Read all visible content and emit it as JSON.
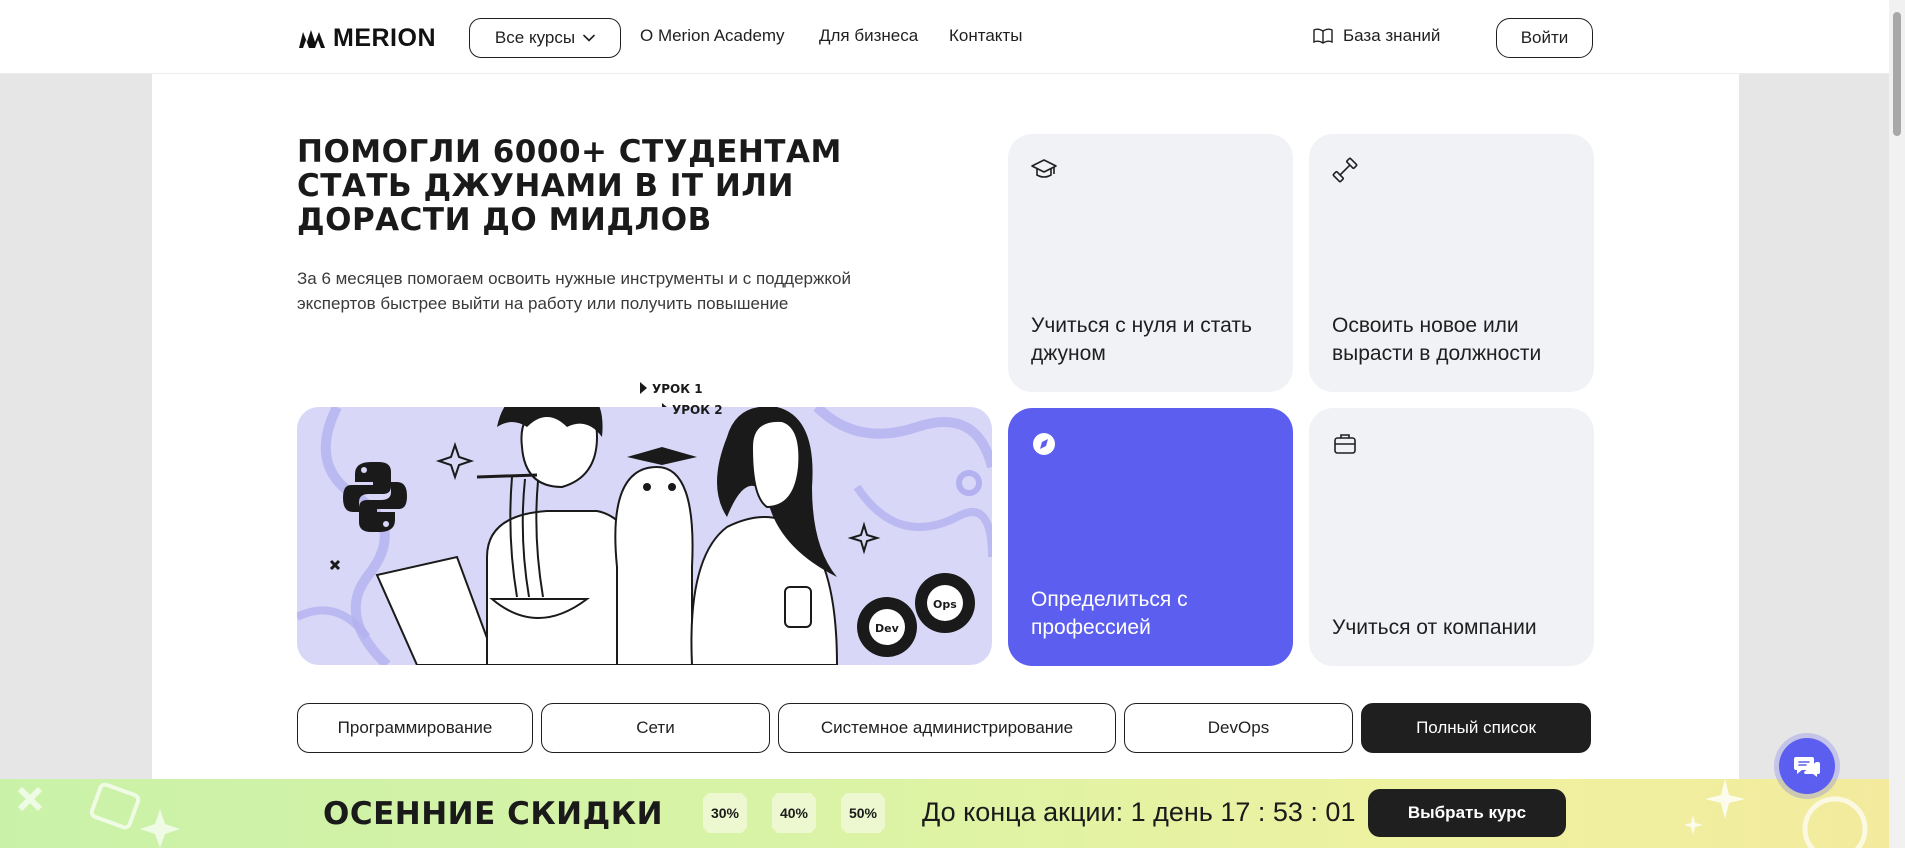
{
  "header": {
    "logo_text": "MERION",
    "courses_button": "Все курсы",
    "nav": [
      "О Merion Academy",
      "Для бизнеса",
      "Контакты"
    ],
    "knowledge_base": "База знаний",
    "login": "Войти"
  },
  "hero": {
    "title": "Помогли 6000+ студентам стать джунами в IT или дорасти до мидлов",
    "subtitle": "За 6 месяцев помогаем освоить нужные инструменты и с поддержкой экспертов быстрее выйти на работу или получить повышение",
    "illustration": {
      "lesson_1": "УРОК 1",
      "lesson_2": "УРОК 2",
      "devops_dev": "Dev",
      "devops_ops": "Ops"
    }
  },
  "cards": [
    {
      "label": "Учиться с нуля и стать джуном",
      "icon": "graduation-cap-icon"
    },
    {
      "label": "Освоить новое или вырасти в должности",
      "icon": "dumbbell-icon"
    },
    {
      "label": "Определиться с профессией",
      "icon": "compass-icon",
      "active": true
    },
    {
      "label": "Учиться от компании",
      "icon": "briefcase-icon"
    }
  ],
  "categories": [
    "Программирование",
    "Сети",
    "Системное администрирование",
    "DevOps",
    "Полный список"
  ],
  "promo": {
    "title": "ОСЕННИЕ СКИДКИ",
    "badges": [
      "30%",
      "40%",
      "50%"
    ],
    "countdown": "До конца акции: 1 день 17 : 53 : 01",
    "button": "Выбрать курс"
  },
  "colors": {
    "accent": "#5c5ef0",
    "card_bg": "#f1f2f6",
    "illustration_bg": "#d8d7f7",
    "dark": "#1f1f1f"
  }
}
